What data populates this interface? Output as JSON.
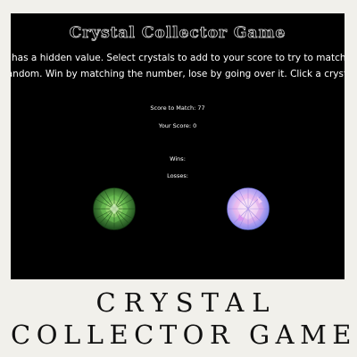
{
  "game": {
    "title": "Crystal Collector Game",
    "instructions": "Each crystal has a hidden value. Select crystals to add to your score to try to match the number chosen at random. Win by matching the number, lose by going over it. Click a crystal to begin!",
    "target_label": "Score to Match: 77",
    "score_label": "Your Score: 0",
    "wins_label": "Wins:",
    "losses_label": "Losses:",
    "crystals": [
      {
        "name": "green-crystal",
        "color": "#3f9a3a"
      },
      {
        "name": "pink-crystal",
        "color": "#c9a8ee"
      }
    ]
  },
  "banner": {
    "line1": "CRYSTAL",
    "line2": "COLLECTOR GAME"
  }
}
